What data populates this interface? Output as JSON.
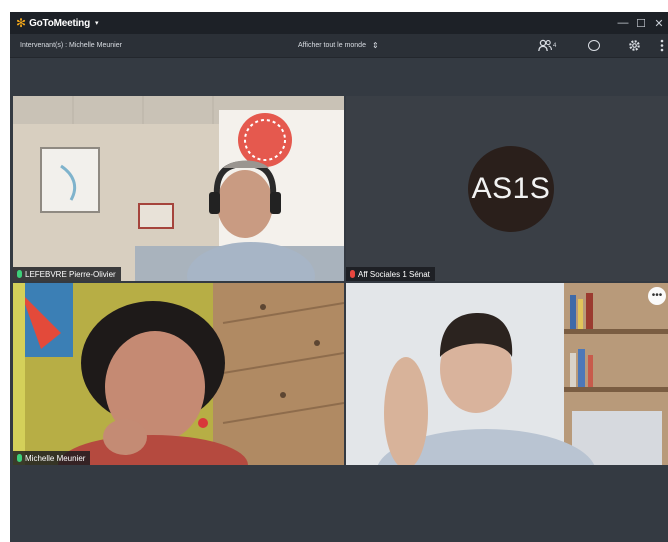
{
  "app": {
    "brand_name": "GoToMeeting",
    "brand_caret": "▾",
    "logo_glyph": "✻",
    "accent": "#f2a71b"
  },
  "window_controls": {
    "minimize": "—",
    "maximize": "☐",
    "close": "✕"
  },
  "toolbar": {
    "speaker_text": "Intervenant(s) : Michelle Meunier",
    "view_label": "Afficher tout le monde",
    "view_updown": "⇕",
    "attendee_count": "4",
    "icons": {
      "attendees": "people-icon",
      "chat": "chat-icon",
      "settings": "gear-icon",
      "more": "more-vertical-icon"
    }
  },
  "tiles": [
    {
      "name": "LEFEBVRE Pierre-Olivier",
      "mic": "active",
      "type": "video"
    },
    {
      "name": "Aff Sociales 1 Sénat",
      "mic": "muted",
      "type": "avatar",
      "initials": "AS1S"
    },
    {
      "name": "Michelle Meunier",
      "mic": "speaking",
      "type": "video"
    },
    {
      "name": "",
      "mic": "",
      "type": "video",
      "menu": "•••"
    }
  ],
  "colors": {
    "window_bg": "#343a42",
    "titlebar_bg": "#1d2127",
    "mic_active": "#3dd07a",
    "mic_muted": "#e8463f"
  }
}
